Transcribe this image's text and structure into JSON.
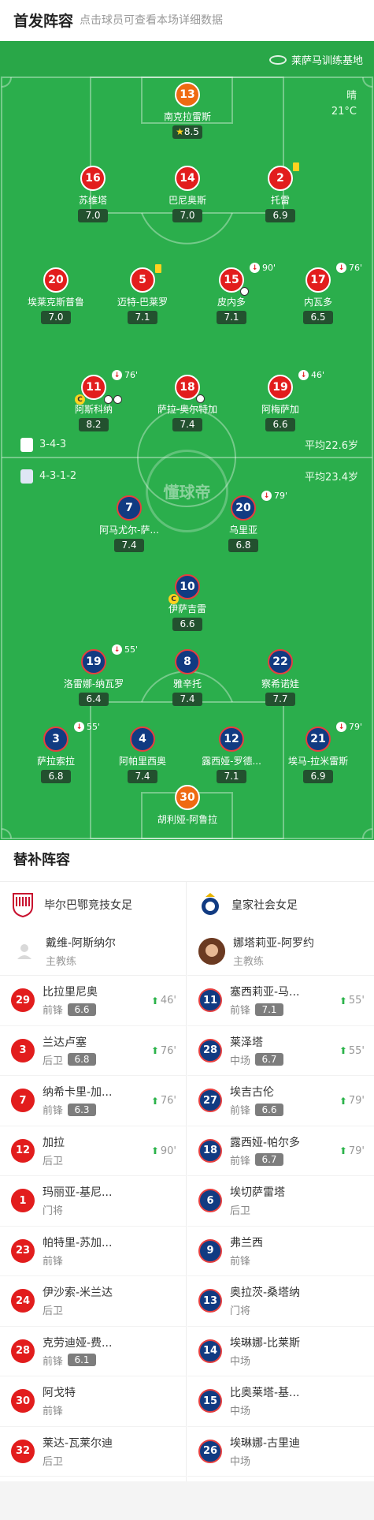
{
  "header": {
    "title": "首发阵容",
    "subtitle": "点击球员可查看本场详细数据"
  },
  "pitch": {
    "venue": "莱萨马训练基地",
    "weather": "晴",
    "temperature": "21°C",
    "watermark": "懂球帝",
    "home_formation": "3-4-3",
    "home_avg_age": "平均22.6岁",
    "away_formation": "4-3-1-2",
    "away_avg_age": "平均23.4岁"
  },
  "home_players": [
    {
      "num": "13",
      "name": "南克拉雷斯",
      "rating": "8.5",
      "star": true
    },
    {
      "num": "16",
      "name": "苏维塔",
      "rating": "7.0"
    },
    {
      "num": "14",
      "name": "巴尼奥斯",
      "rating": "7.0"
    },
    {
      "num": "2",
      "name": "托雷",
      "rating": "6.9",
      "yellow": true
    },
    {
      "num": "20",
      "name": "埃莱克斯普鲁",
      "rating": "7.0"
    },
    {
      "num": "5",
      "name": "迈特-巴莱罗",
      "rating": "7.1",
      "yellow": true
    },
    {
      "num": "15",
      "name": "皮内多",
      "rating": "7.1",
      "sub": "90'"
    },
    {
      "num": "17",
      "name": "内瓦多",
      "rating": "6.5",
      "sub": "76'"
    },
    {
      "num": "11",
      "name": "阿斯科纳",
      "rating": "8.2",
      "sub": "76'",
      "captain": "C"
    },
    {
      "num": "18",
      "name": "萨拉-奥尔特加",
      "rating": "7.4"
    },
    {
      "num": "19",
      "name": "阿梅萨加",
      "rating": "6.6",
      "sub": "46'"
    }
  ],
  "away_players": [
    {
      "num": "7",
      "name": "阿马尤尔-萨尔塞多",
      "name_display": "阿马尤尔-萨...",
      "rating": "7.4"
    },
    {
      "num": "20",
      "name": "乌里亚",
      "rating": "6.8",
      "sub": "79'"
    },
    {
      "num": "10",
      "name": "伊萨吉雷",
      "rating": "6.6",
      "captain": "C"
    },
    {
      "num": "19",
      "name": "洛雷娜-纳瓦罗",
      "rating": "6.4",
      "sub": "55'"
    },
    {
      "num": "8",
      "name": "雅辛托",
      "rating": "7.4"
    },
    {
      "num": "22",
      "name": "察希诺娃",
      "rating": "7.7"
    },
    {
      "num": "3",
      "name": "萨拉索拉",
      "rating": "6.8",
      "sub": "55'"
    },
    {
      "num": "4",
      "name": "阿帕里西奥",
      "rating": "7.4"
    },
    {
      "num": "12",
      "name": "露西娅-罗德里格斯",
      "name_display": "露西娅-罗德...",
      "rating": "7.1"
    },
    {
      "num": "21",
      "name": "埃马-拉米雷斯",
      "rating": "6.9",
      "sub": "79'"
    },
    {
      "num": "30",
      "name": "胡利娅-阿鲁拉"
    }
  ],
  "subs": {
    "title": "替补阵容",
    "home": {
      "team": "毕尔巴鄂竞技女足",
      "coach": "戴维-阿斯纳尔",
      "coach_role": "主教练",
      "players": [
        {
          "num": "29",
          "name": "比拉里尼奥",
          "pos": "前锋",
          "rating": "6.6",
          "sub": "46'"
        },
        {
          "num": "3",
          "name": "兰达卢塞",
          "pos": "后卫",
          "rating": "6.8",
          "sub": "76'"
        },
        {
          "num": "7",
          "name": "纳希卡里-加...",
          "pos": "前锋",
          "rating": "6.3",
          "sub": "76'"
        },
        {
          "num": "12",
          "name": "加拉",
          "pos": "后卫",
          "sub": "90'"
        },
        {
          "num": "1",
          "name": "玛丽亚-基尼...",
          "pos": "门将"
        },
        {
          "num": "23",
          "name": "帕特里-苏加...",
          "pos": "前锋"
        },
        {
          "num": "24",
          "name": "伊沙索-米兰达",
          "pos": "后卫"
        },
        {
          "num": "28",
          "name": "克劳迪娅-费...",
          "pos": "前锋",
          "rating": "6.1"
        },
        {
          "num": "30",
          "name": "阿戈特",
          "pos": "前锋"
        },
        {
          "num": "32",
          "name": "莱达-瓦莱尔迪",
          "pos": "后卫"
        }
      ]
    },
    "away": {
      "team": "皇家社会女足",
      "coach": "娜塔莉亚-阿罗约",
      "coach_role": "主教练",
      "players": [
        {
          "num": "11",
          "name": "塞西莉亚-马...",
          "pos": "前锋",
          "rating": "7.1",
          "sub": "55'"
        },
        {
          "num": "28",
          "name": "莱泽塔",
          "pos": "中场",
          "rating": "6.7",
          "sub": "55'"
        },
        {
          "num": "27",
          "name": "埃吉古伦",
          "pos": "前锋",
          "rating": "6.6",
          "sub": "79'"
        },
        {
          "num": "18",
          "name": "露西娅-帕尔多",
          "pos": "前锋",
          "rating": "6.7",
          "sub": "79'"
        },
        {
          "num": "6",
          "name": "埃切萨雷塔",
          "pos": "后卫"
        },
        {
          "num": "9",
          "name": "弗兰西",
          "pos": "前锋"
        },
        {
          "num": "13",
          "name": "奥拉茨-桑塔纳",
          "pos": "门将"
        },
        {
          "num": "14",
          "name": "埃琳娜-比莱斯",
          "pos": "中场"
        },
        {
          "num": "15",
          "name": "比奥莱塔-基...",
          "pos": "中场"
        },
        {
          "num": "26",
          "name": "埃琳娜-古里迪",
          "pos": "中场"
        }
      ]
    }
  },
  "colors": {
    "pitch": "#2bae4c",
    "home": "#e21d1d",
    "away": "#113b82",
    "away_gk": "#ef6a12",
    "accent_up": "#2bb34a"
  }
}
